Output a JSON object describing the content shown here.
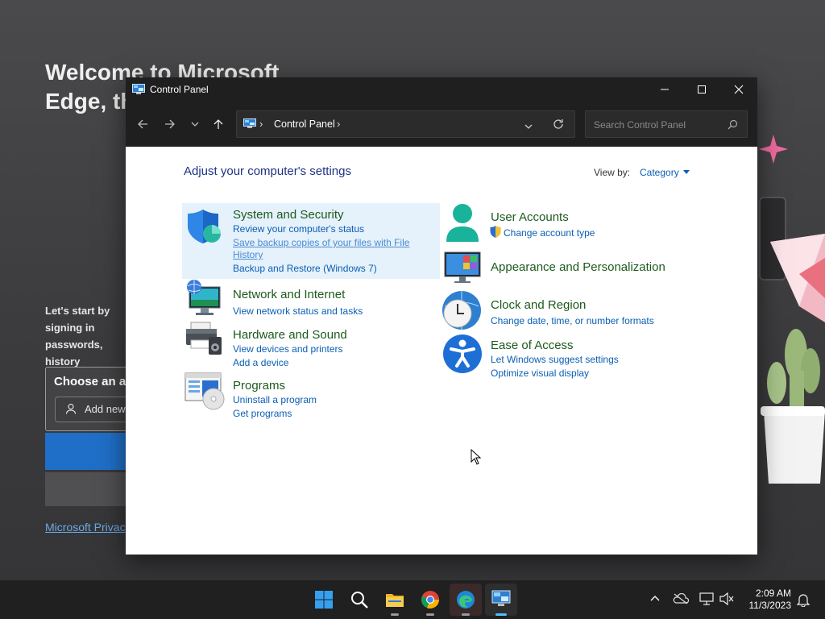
{
  "background": {
    "title": "Welcome to Microsoft Edge, the browser",
    "subtitle": "Let's start by signing in passwords, history",
    "card_title": "Choose an a",
    "card_button": "Add new",
    "privacy_link": "Microsoft Privac"
  },
  "window": {
    "title": "Control Panel",
    "icon": "control-panel-icon",
    "controls": [
      "minimize",
      "maximize",
      "close"
    ]
  },
  "toolbar": {
    "breadcrumb": "Control Panel",
    "search_placeholder": "Search Control Panel"
  },
  "content": {
    "heading": "Adjust your computer's settings",
    "view_by_label": "View by:",
    "view_by_value": "Category",
    "left_categories": [
      {
        "name": "System and Security",
        "icon": "shield-icon",
        "links": [
          "Review your computer's status",
          "Save backup copies of your files with File",
          "History",
          "Backup and Restore (Windows 7)"
        ]
      },
      {
        "name": "Network and Internet",
        "icon": "globe-monitor-icon",
        "links": [
          "View network status and tasks"
        ]
      },
      {
        "name": "Hardware and Sound",
        "icon": "printer-speaker-icon",
        "links": [
          "View devices and printers",
          "Add a device"
        ]
      },
      {
        "name": "Programs",
        "icon": "programs-disc-icon",
        "links": [
          "Uninstall a program",
          "Get programs"
        ]
      }
    ],
    "right_categories": [
      {
        "name": "User Accounts",
        "icon": "user-icon",
        "links": [
          "Change account type"
        ]
      },
      {
        "name": "Appearance and Personalization",
        "icon": "monitor-tiles-icon",
        "links": []
      },
      {
        "name": "Clock and Region",
        "icon": "clock-globe-icon",
        "links": [
          "Change date, time, or number formats"
        ]
      },
      {
        "name": "Ease of Access",
        "icon": "accessibility-icon",
        "links": [
          "Let Windows suggest settings",
          "Optimize visual display"
        ]
      }
    ]
  },
  "taskbar": {
    "apps": [
      "start-icon",
      "search-icon",
      "file-explorer-icon",
      "chrome-icon",
      "edge-icon",
      "control-panel-icon"
    ],
    "tray": [
      "chevron-up-icon",
      "onedrive-icon",
      "network-icon",
      "volume-muted-icon"
    ],
    "time": "2:09 AM",
    "date": "11/3/2023"
  },
  "colors": {
    "link": "#0a5fb4",
    "category_title": "#1d5a1d",
    "heading": "#1e3287",
    "titlebar": "#1f1f1f",
    "highlight": "#e5f1fb"
  }
}
